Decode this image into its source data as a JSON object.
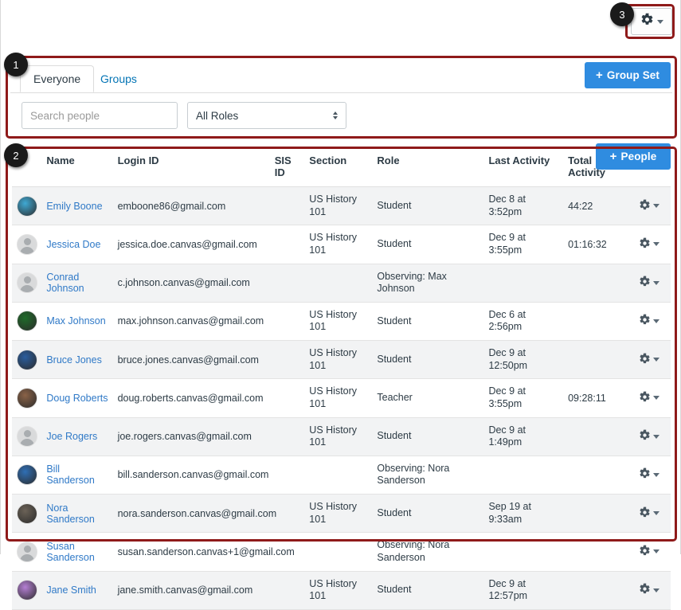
{
  "topbar": {
    "settings_gear": "gear-icon",
    "annotation_badge": "3"
  },
  "annotations": {
    "badge1": "1",
    "badge2": "2",
    "badge3": "3"
  },
  "tabs": [
    {
      "label": "Everyone",
      "active": true
    },
    {
      "label": "Groups",
      "active": false
    }
  ],
  "buttons": {
    "group_set": "Group Set",
    "people": "People",
    "plus": "+"
  },
  "search": {
    "placeholder": "Search people",
    "value": ""
  },
  "role_filter": {
    "selected": "All Roles"
  },
  "table": {
    "headers": {
      "avatar": "",
      "name": "Name",
      "login_id": "Login ID",
      "sis_id": "SIS ID",
      "section": "Section",
      "role": "Role",
      "last_activity": "Last Activity",
      "total_activity": "Total Activity",
      "actions": ""
    },
    "rows": [
      {
        "name": "Emily Boone",
        "login_id": "emboone86@gmail.com",
        "sis_id": "",
        "section": "US History 101",
        "role": "Student",
        "last_activity": "Dec 8 at 3:52pm",
        "total_activity": "44:22",
        "avatar_type": "image",
        "avatar_color": "#3fa9d4"
      },
      {
        "name": "Jessica Doe",
        "login_id": "jessica.doe.canvas@gmail.com",
        "sis_id": "",
        "section": "US History 101",
        "role": "Student",
        "last_activity": "Dec 9 at 3:55pm",
        "total_activity": "01:16:32",
        "avatar_type": "generic",
        "avatar_color": "#d9dadb"
      },
      {
        "name": "Conrad Johnson",
        "login_id": "c.johnson.canvas@gmail.com",
        "sis_id": "",
        "section": "",
        "role": "Observing: Max Johnson",
        "last_activity": "",
        "total_activity": "",
        "avatar_type": "generic",
        "avatar_color": "#d9dadb"
      },
      {
        "name": "Max Johnson",
        "login_id": "max.johnson.canvas@gmail.com",
        "sis_id": "",
        "section": "US History 101",
        "role": "Student",
        "last_activity": "Dec 6 at 2:56pm",
        "total_activity": "",
        "avatar_type": "image",
        "avatar_color": "#1f6b2a"
      },
      {
        "name": "Bruce Jones",
        "login_id": "bruce.jones.canvas@gmail.com",
        "sis_id": "",
        "section": "US History 101",
        "role": "Student",
        "last_activity": "Dec 9 at 12:50pm",
        "total_activity": "",
        "avatar_type": "image",
        "avatar_color": "#2a5d9e"
      },
      {
        "name": "Doug Roberts",
        "login_id": "doug.roberts.canvas@gmail.com",
        "sis_id": "",
        "section": "US History 101",
        "role": "Teacher",
        "last_activity": "Dec 9 at 3:55pm",
        "total_activity": "09:28:11",
        "avatar_type": "image",
        "avatar_color": "#8a6247"
      },
      {
        "name": "Joe Rogers",
        "login_id": "joe.rogers.canvas@gmail.com",
        "sis_id": "",
        "section": "US History 101",
        "role": "Student",
        "last_activity": "Dec 9 at 1:49pm",
        "total_activity": "",
        "avatar_type": "generic",
        "avatar_color": "#d9dadb"
      },
      {
        "name": "Bill Sanderson",
        "login_id": "bill.sanderson.canvas@gmail.com",
        "sis_id": "",
        "section": "",
        "role": "Observing: Nora Sanderson",
        "last_activity": "",
        "total_activity": "",
        "avatar_type": "image",
        "avatar_color": "#2f6fb5"
      },
      {
        "name": "Nora Sanderson",
        "login_id": "nora.sanderson.canvas@gmail.com",
        "sis_id": "",
        "section": "US History 101",
        "role": "Student",
        "last_activity": "Sep 19 at 9:33am",
        "total_activity": "",
        "avatar_type": "image",
        "avatar_color": "#6b6257"
      },
      {
        "name": "Susan Sanderson",
        "login_id": "susan.sanderson.canvas+1@gmail.com",
        "sis_id": "",
        "section": "",
        "role": "Observing: Nora Sanderson",
        "last_activity": "",
        "total_activity": "",
        "avatar_type": "generic",
        "avatar_color": "#d9dadb"
      },
      {
        "name": "Jane Smith",
        "login_id": "jane.smith.canvas@gmail.com",
        "sis_id": "",
        "section": "US History 101",
        "role": "Student",
        "last_activity": "Dec 9 at 12:57pm",
        "total_activity": "",
        "avatar_type": "image",
        "avatar_color": "#b57fd4"
      }
    ]
  },
  "colors": {
    "accent_blue": "#2f8ce0",
    "link_blue": "#2f79c7",
    "annotation_red": "#8f1a1a",
    "row_stripe": "#f2f3f4"
  }
}
